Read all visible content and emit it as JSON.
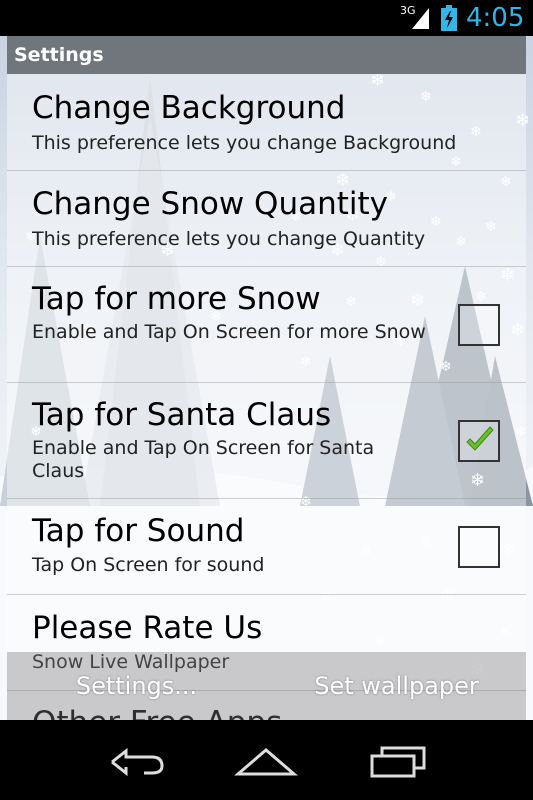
{
  "status_bar": {
    "network_type": "3G",
    "time": "4:05",
    "accent_color": "#33b5e5"
  },
  "dialog": {
    "title": "Settings"
  },
  "preferences": [
    {
      "title": "Change Background",
      "summary": "This preference lets you change Background",
      "has_checkbox": false
    },
    {
      "title": "Change Snow Quantity",
      "summary": "This preference lets you change Quantity",
      "has_checkbox": false
    },
    {
      "title": "Tap for more Snow",
      "summary": "Enable and Tap On Screen for more Snow",
      "has_checkbox": true,
      "checked": false
    },
    {
      "title": "Tap for Santa Claus",
      "summary": "Enable and Tap On Screen for Santa Claus",
      "has_checkbox": true,
      "checked": true
    },
    {
      "title": "Tap for Sound",
      "summary": "Tap On Screen for sound",
      "has_checkbox": true,
      "checked": false
    },
    {
      "title": "Please Rate Us",
      "summary": "Snow Live Wallpaper",
      "has_checkbox": false
    },
    {
      "title": "Other Free Apps",
      "summary": "",
      "has_checkbox": false
    }
  ],
  "button_bar": {
    "settings_label": "Settings...",
    "set_wallpaper_label": "Set wallpaper"
  },
  "nav_bar": {
    "icons": [
      "back-icon",
      "home-icon",
      "recent-apps-icon"
    ]
  },
  "colors": {
    "check_green": "#6abf2a",
    "title_bar": "#696e73"
  }
}
